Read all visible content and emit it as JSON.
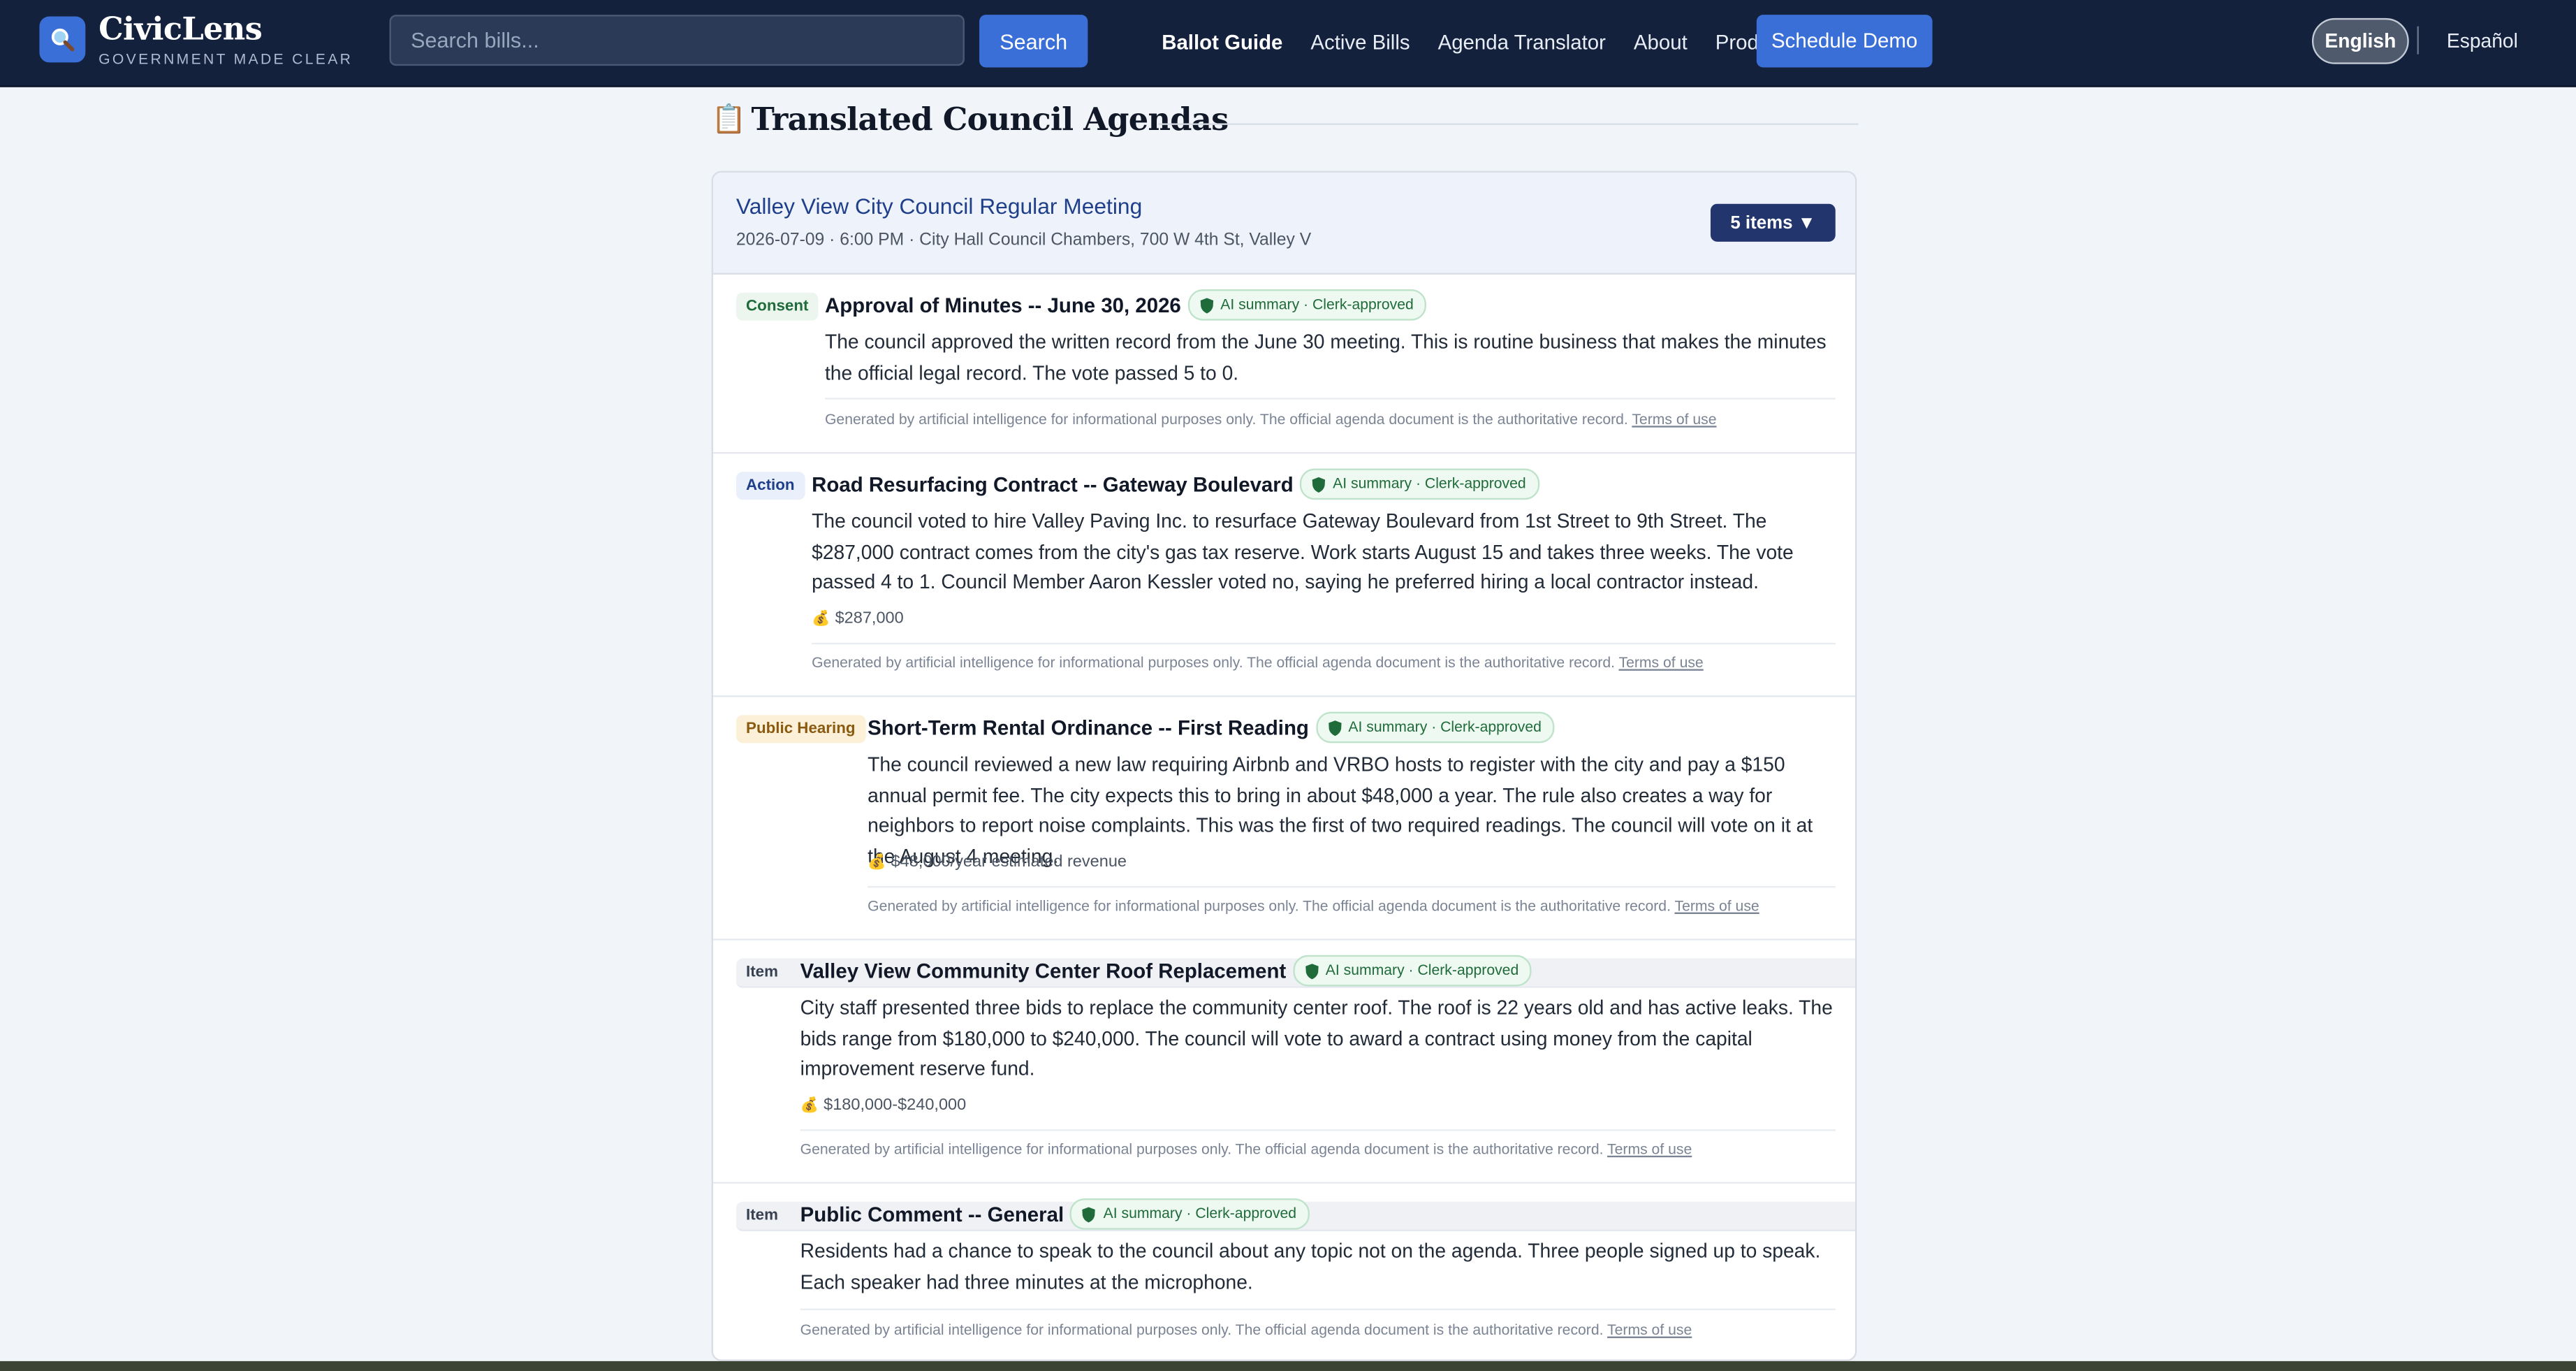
{
  "header": {
    "brand_name": "CivicLens",
    "brand_tagline": "GOVERNMENT MADE CLEAR",
    "logo_icon": "magnifier-icon",
    "search_placeholder": "Search bills...",
    "search_button": "Search",
    "nav": [
      "Ballot Guide",
      "Active Bills",
      "Agenda Translator",
      "About",
      "Product"
    ],
    "active_nav": "Ballot Guide",
    "demo_button": "Schedule Demo",
    "lang_en": "English",
    "lang_es": "Español"
  },
  "section": {
    "icon": "clipboard-icon",
    "title": "Translated Council Agendas"
  },
  "meeting": {
    "title": "Valley View City Council Regular Meeting",
    "meta": "2026-07-09 · 6:00 PM · City Hall Council Chambers, 700 W 4th St, Valley V",
    "items_button": "5 items ▼"
  },
  "items": [
    {
      "tag": "Consent",
      "title": "Approval of Minutes -- June 30, 2026",
      "badge": "AI summary · Clerk-approved",
      "body": "The council approved the written record from the June 30 meeting. This is routine business that makes the minutes the official legal record. The vote passed 5 to 0.",
      "money": ""
    },
    {
      "tag": "Action",
      "title": "Road Resurfacing Contract -- Gateway Boulevard",
      "badge": "AI summary · Clerk-approved",
      "body": "The council voted to hire Valley Paving Inc. to resurface Gateway Boulevard from 1st Street to 9th Street. The $287,000 contract comes from the city's gas tax reserve. Work starts August 15 and takes three weeks. The vote passed 4 to 1. Council Member Aaron Kessler voted no, saying he preferred hiring a local contractor instead.",
      "money": "$287,000"
    },
    {
      "tag": "Public Hearing",
      "title": "Short-Term Rental Ordinance -- First Reading",
      "badge": "AI summary · Clerk-approved",
      "body": "The council reviewed a new law requiring Airbnb and VRBO hosts to register with the city and pay a $150 annual permit fee. The city expects this to bring in about $48,000 a year. The rule also creates a way for neighbors to report noise complaints. This was the first of two required readings. The council will vote on it at the August 4 meeting.",
      "money": "$48,000/year estimated revenue"
    },
    {
      "tag": "Item",
      "title": "Valley View Community Center Roof Replacement",
      "badge": "AI summary · Clerk-approved",
      "body": "City staff presented three bids to replace the community center roof. The roof is 22 years old and has active leaks. The bids range from $180,000 to $240,000. The council will vote to award a contract using money from the capital improvement reserve fund.",
      "money": "$180,000-$240,000"
    },
    {
      "tag": "Item",
      "title": "Public Comment -- General",
      "badge": "AI summary · Clerk-approved",
      "body": "Residents had a chance to speak to the council about any topic not on the agenda. Three people signed up to speak. Each speaker had three minutes at the microphone.",
      "money": ""
    }
  ],
  "disclaimer": {
    "text": "Generated by artificial intelligence for informational purposes only. The official agenda document is the authoritative record.",
    "link": "Terms of use"
  },
  "colors": {
    "header_bg": "#14213d",
    "accent": "#3b6fd8",
    "meeting_title": "#1f3f8a"
  }
}
